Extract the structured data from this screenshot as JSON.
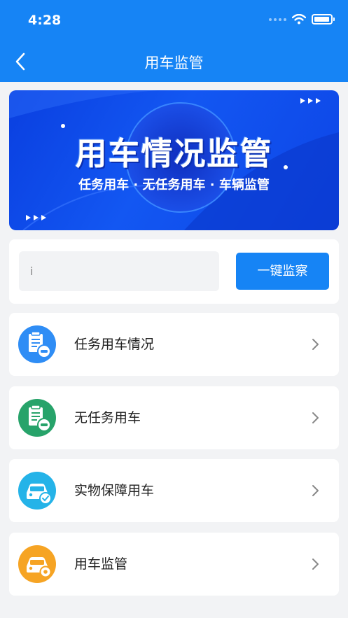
{
  "status": {
    "time": "4:28"
  },
  "header": {
    "title": "用车监管"
  },
  "banner": {
    "title": "用车情况监管",
    "subtitle": "任务用车 · 无任务用车 · 车辆监管"
  },
  "search": {
    "value": "",
    "placeholder": "i",
    "button_label": "一键监察"
  },
  "menu": {
    "items": [
      {
        "label": "任务用车情况",
        "icon": "task-vehicle-icon",
        "color": "#2f8df5"
      },
      {
        "label": "无任务用车",
        "icon": "no-task-vehicle-icon",
        "color": "#27a36a"
      },
      {
        "label": "实物保障用车",
        "icon": "vehicle-check-icon",
        "color": "#25b3e8"
      },
      {
        "label": "用车监管",
        "icon": "vehicle-settings-icon",
        "color": "#f6a424"
      }
    ]
  },
  "colors": {
    "primary": "#1684f5",
    "background": "#f2f3f5"
  }
}
